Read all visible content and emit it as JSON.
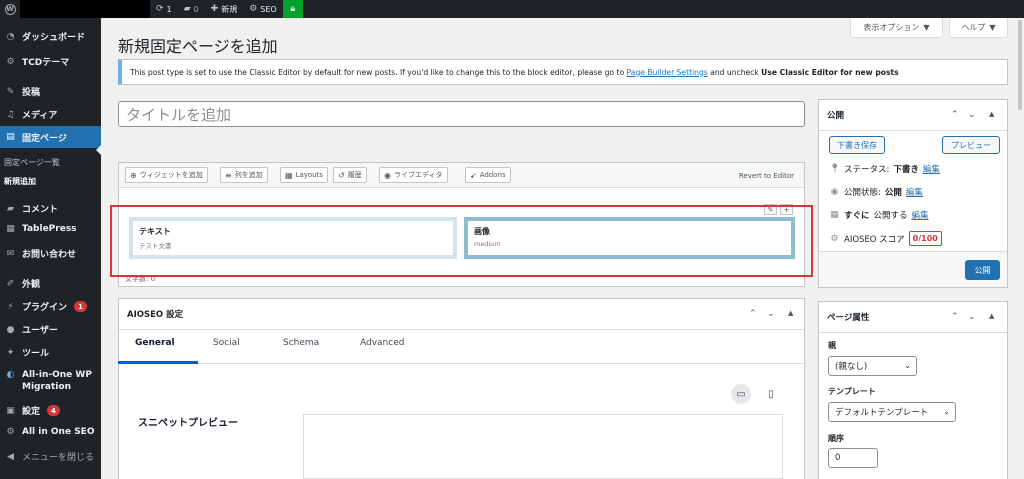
{
  "adminbar": {
    "updates_count": "1",
    "comments_count": "0",
    "new_label": "新規",
    "seo_label": "SEO"
  },
  "sidebar": {
    "items": [
      {
        "label": "ダッシュボード",
        "icon": "dashboard-icon"
      },
      {
        "label": "TCDテーマ",
        "icon": "theme-icon"
      },
      {
        "label": "投稿",
        "icon": "pin-icon"
      },
      {
        "label": "メディア",
        "icon": "media-icon"
      },
      {
        "label": "固定ページ",
        "icon": "page-icon"
      },
      {
        "label": "コメント",
        "icon": "comment-icon"
      },
      {
        "label": "TablePress",
        "icon": "table-icon"
      },
      {
        "label": "お問い合わせ",
        "icon": "mail-icon"
      },
      {
        "label": "外観",
        "icon": "brush-icon"
      },
      {
        "label": "プラグイン",
        "icon": "plugin-icon",
        "badge": "1"
      },
      {
        "label": "ユーザー",
        "icon": "user-icon"
      },
      {
        "label": "ツール",
        "icon": "wrench-icon"
      },
      {
        "label": "All-in-One WP",
        "label2": "Migration",
        "icon": "migration-icon"
      },
      {
        "label": "設定",
        "icon": "settings-icon",
        "badge": "4"
      },
      {
        "label": "All in One SEO",
        "icon": "seo-icon"
      },
      {
        "label": "メニューを閉じる",
        "icon": "collapse-icon"
      }
    ],
    "submenu": [
      "固定ページ一覧",
      "新規追加"
    ]
  },
  "screen_options": {
    "label": "表示オプション",
    "help": "ヘルプ"
  },
  "page_title": "新規固定ページを追加",
  "notice": {
    "text1": "This post type is set to use the Classic Editor by default for new posts. If you'd like to change this to the block editor, please go to",
    "link": "Page Builder Settings",
    "text2": "and uncheck",
    "bold": "Use Classic Editor for new posts"
  },
  "title_placeholder": "タイトルを追加",
  "page_builder": {
    "toolbar": [
      {
        "label": "ウィジェットを追加",
        "icon": "widget-icon"
      },
      {
        "label": "列を追加",
        "icon": "columns-icon"
      },
      {
        "label": "Layouts",
        "icon": "layouts-icon"
      },
      {
        "label": "履歴",
        "icon": "history-icon"
      },
      {
        "label": "ライブエディタ",
        "icon": "eye-icon"
      },
      {
        "label": "Addons",
        "icon": "rocket-icon"
      }
    ],
    "revert": "Revert to Editor",
    "widgets": [
      {
        "title": "テキスト",
        "desc": "テスト文書"
      },
      {
        "title": "画像",
        "desc": "medium"
      }
    ],
    "word_count": "文字数: 0"
  },
  "aioseo": {
    "title": "AIOSEO 設定",
    "tabs": [
      "General",
      "Social",
      "Schema",
      "Advanced"
    ],
    "snippet_label": "スニペットプレビュー"
  },
  "publish": {
    "title": "公開",
    "save_draft": "下書き保存",
    "preview": "プレビュー",
    "status_label": "ステータス:",
    "status_value": "下書き",
    "visibility_label": "公開状態:",
    "visibility_value": "公開",
    "schedule_value": "すぐに",
    "schedule_label": "公開する",
    "edit": "編集",
    "score_label": "AIOSEO スコア",
    "score_value": "0/100",
    "publish_button": "公開"
  },
  "page_attributes": {
    "title": "ページ属性",
    "parent_label": "親",
    "parent_value": "(親なし)",
    "template_label": "テンプレート",
    "template_value": "デフォルトテンプレート",
    "order_label": "順序",
    "order_value": "0"
  }
}
